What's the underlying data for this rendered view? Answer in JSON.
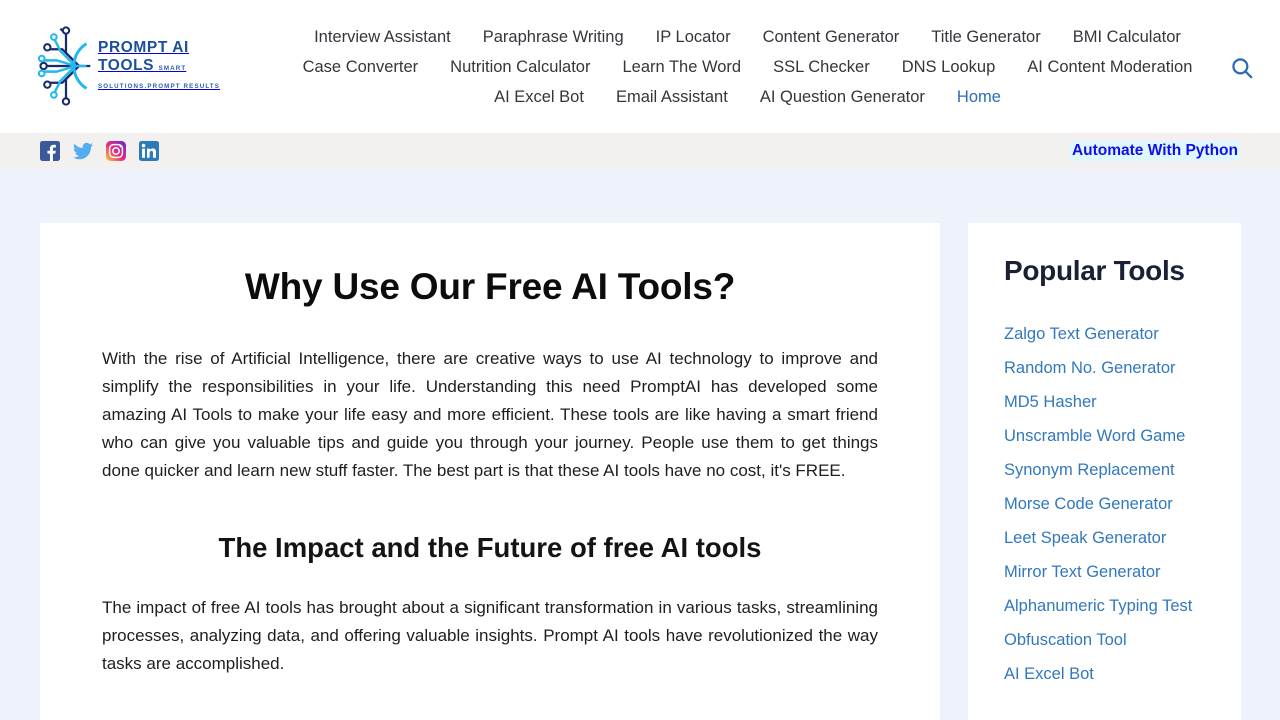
{
  "header": {
    "logo": {
      "title": "PROMPT AI TOOLS",
      "tagline": "SMART SOLUTIONS.PROMPT RESULTS",
      "icon": "circuit-network-icon"
    },
    "search_icon": "search-icon",
    "nav_rows": [
      [
        {
          "label": "Interview Assistant",
          "active": false
        },
        {
          "label": "Paraphrase Writing",
          "active": false
        },
        {
          "label": "IP Locator",
          "active": false
        },
        {
          "label": "Content Generator",
          "active": false
        },
        {
          "label": "Title Generator",
          "active": false
        },
        {
          "label": "BMI Calculator",
          "active": false
        }
      ],
      [
        {
          "label": "Case Converter",
          "active": false
        },
        {
          "label": "Nutrition Calculator",
          "active": false
        },
        {
          "label": "Learn The Word",
          "active": false
        },
        {
          "label": "SSL Checker",
          "active": false
        },
        {
          "label": "DNS Lookup",
          "active": false
        },
        {
          "label": "AI Content Moderation",
          "active": false
        }
      ],
      [
        {
          "label": "AI Excel Bot",
          "active": false
        },
        {
          "label": "Email Assistant",
          "active": false
        },
        {
          "label": "AI Question Generator",
          "active": false
        },
        {
          "label": "Home",
          "active": true
        }
      ]
    ]
  },
  "social_bar": {
    "icons": [
      {
        "name": "facebook-icon",
        "color": "#3b5998"
      },
      {
        "name": "twitter-icon",
        "color": "#55acee"
      },
      {
        "name": "instagram-icon",
        "color": "#8a3ab9"
      },
      {
        "name": "linkedin-icon",
        "color": "#2a7bb8"
      }
    ],
    "promo": {
      "label": "Automate With Python",
      "color": "#1010e8",
      "highlight": "#dff8ff"
    }
  },
  "main": {
    "heading": "Why Use Our Free AI Tools?",
    "paragraph1": "With the rise of Artificial Intelligence, there are creative ways to use AI technology to improve and simplify the responsibilities in your life. Understanding this need PromptAI has developed some amazing AI Tools to make your life easy and more efficient. These tools are like having a smart friend who can give you valuable tips and guide you through your journey. People use them to get things done quicker and learn new stuff faster. The best part is that these AI tools have no cost, it's FREE.",
    "subheading": "The Impact and the Future of free AI tools",
    "paragraph2": "The impact of free AI tools has brought about a significant transformation in various tasks, streamlining processes, analyzing data, and offering valuable insights. Prompt AI tools have revolutionized the way tasks are accomplished."
  },
  "sidebar": {
    "title": "Popular Tools",
    "items": [
      {
        "label": "Zalgo Text Generator"
      },
      {
        "label": "Random No. Generator"
      },
      {
        "label": "MD5 Hasher"
      },
      {
        "label": "Unscramble Word Game"
      },
      {
        "label": "Synonym Replacement"
      },
      {
        "label": "Morse Code Generator"
      },
      {
        "label": "Leet Speak Generator"
      },
      {
        "label": "Mirror Text Generator"
      },
      {
        "label": "Alphanumeric Typing Test"
      },
      {
        "label": "Obfuscation Tool"
      },
      {
        "label": "AI Excel Bot"
      }
    ]
  },
  "theme": {
    "page_background": "#eef2fa",
    "card_background": "#ffffff",
    "social_bar_background": "#f2f1ef",
    "link_color": "#3178bd",
    "nav_text_color": "#33363b"
  }
}
